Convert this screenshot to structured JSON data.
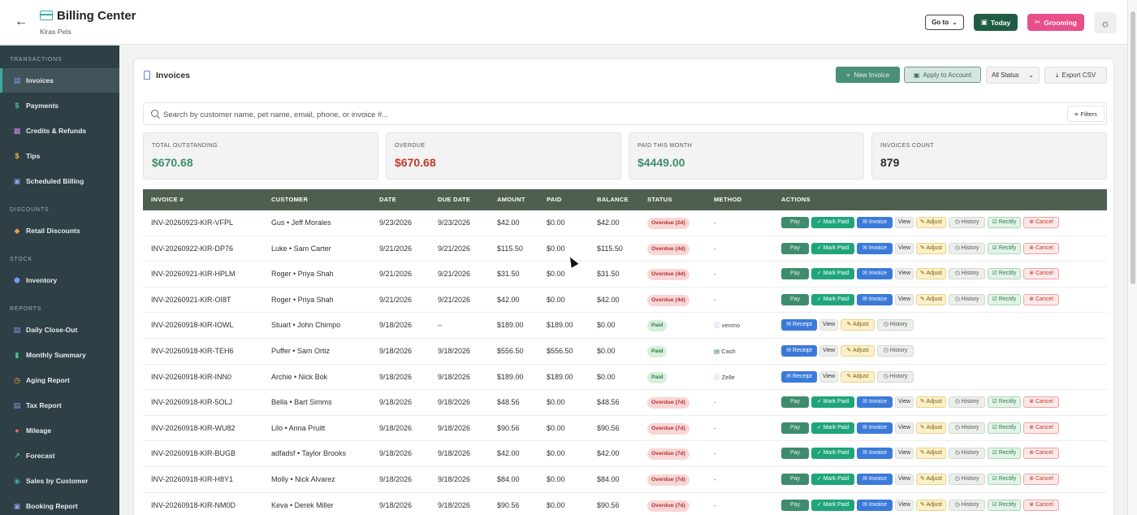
{
  "header": {
    "title": "Billing Center",
    "subtitle": "Kiras Pets",
    "goto_label": "Go to",
    "today_label": "Today",
    "grooming_label": "Grooming",
    "back_icon": "arrow-left-icon",
    "theme_icon": "sun-icon"
  },
  "sidebar": {
    "sections": [
      {
        "label": "TRANSACTIONS",
        "items": [
          {
            "label": "Invoices",
            "icon": "document-icon",
            "active": true
          },
          {
            "label": "Payments",
            "icon": "dollar-icon"
          },
          {
            "label": "Credits & Refunds",
            "icon": "gift-icon"
          },
          {
            "label": "Tips",
            "icon": "dollar-icon"
          },
          {
            "label": "Scheduled Billing",
            "icon": "calendar-icon"
          }
        ]
      },
      {
        "label": "DISCOUNTS",
        "items": [
          {
            "label": "Retail Discounts",
            "icon": "tag-icon"
          }
        ]
      },
      {
        "label": "STOCK",
        "items": [
          {
            "label": "Inventory",
            "icon": "box-icon"
          }
        ]
      },
      {
        "label": "REPORTS",
        "items": [
          {
            "label": "Daily Close-Out",
            "icon": "clipboard-icon"
          },
          {
            "label": "Monthly Summary",
            "icon": "bar-chart-icon"
          },
          {
            "label": "Aging Report",
            "icon": "clock-icon"
          },
          {
            "label": "Tax Report",
            "icon": "receipt-icon"
          },
          {
            "label": "Mileage",
            "icon": "map-pin-icon"
          },
          {
            "label": "Forecast",
            "icon": "trend-icon"
          },
          {
            "label": "Sales by Customer",
            "icon": "users-icon"
          },
          {
            "label": "Booking Report",
            "icon": "calendar-icon"
          }
        ]
      }
    ]
  },
  "invoices": {
    "title": "Invoices",
    "new_label": "New Invoice",
    "apply_label": "Apply to Account",
    "status_filter": "All Status",
    "export_label": "Export CSV",
    "search_placeholder": "Search by customer name, pet name, email, phone, or invoice #...",
    "filters_label": "Filters"
  },
  "stats": [
    {
      "label": "TOTAL OUTSTANDING",
      "value": "$670.68",
      "color": "#3f8f6e"
    },
    {
      "label": "OVERDUE",
      "value": "$670.68",
      "color": "#c0392b"
    },
    {
      "label": "PAID THIS MONTH",
      "value": "$4449.00",
      "color": "#3f8f6e"
    },
    {
      "label": "INVOICES COUNT",
      "value": "879",
      "color": "#2b2f2b"
    }
  ],
  "table": {
    "columns": [
      "INVOICE #",
      "CUSTOMER",
      "DATE",
      "DUE DATE",
      "AMOUNT",
      "PAID",
      "BALANCE",
      "STATUS",
      "METHOD",
      "ACTIONS"
    ],
    "action_labels": {
      "pay": "Pay",
      "mark_paid": "Mark Paid",
      "invoice": "Invoice",
      "view": "View",
      "adjust": "Adjust",
      "history": "History",
      "rectify": "Rectify",
      "cancel": "Cancel",
      "receipt": "Receipt"
    },
    "rows": [
      {
        "invoice": "INV-20260923-KIR-VFPL",
        "customer": "Gus • Jeff Morales",
        "date": "9/23/2026",
        "due": "9/23/2026",
        "amount": "$42.00",
        "paid": "$0.00",
        "balance": "$42.00",
        "status": "Overdue (2d)",
        "status_type": "overdue",
        "method": "-"
      },
      {
        "invoice": "INV-20260922-KIR-DP76",
        "customer": "Luke • Sam Carter",
        "date": "9/21/2026",
        "due": "9/21/2026",
        "amount": "$115.50",
        "paid": "$0.00",
        "balance": "$115.50",
        "status": "Overdue (4d)",
        "status_type": "overdue",
        "method": "-"
      },
      {
        "invoice": "INV-20260921-KIR-HPLM",
        "customer": "Roger • Priya Shah",
        "date": "9/21/2026",
        "due": "9/21/2026",
        "amount": "$31.50",
        "paid": "$0.00",
        "balance": "$31.50",
        "status": "Overdue (4d)",
        "status_type": "overdue",
        "method": "-"
      },
      {
        "invoice": "INV-20260921-KIR-OI8T",
        "customer": "Roger • Priya Shah",
        "date": "9/21/2026",
        "due": "9/21/2026",
        "amount": "$42.00",
        "paid": "$0.00",
        "balance": "$42.00",
        "status": "Overdue (4d)",
        "status_type": "overdue",
        "method": "-"
      },
      {
        "invoice": "INV-20260918-KIR-IOWL",
        "customer": "Stuart • John Chimpo",
        "date": "9/18/2026",
        "due": "–",
        "amount": "$189.00",
        "paid": "$189.00",
        "balance": "$0.00",
        "status": "Paid",
        "status_type": "paid",
        "method": "venmo"
      },
      {
        "invoice": "INV-20260918-KIR-TEH6",
        "customer": "Puffer • Sam Ortiz",
        "date": "9/18/2026",
        "due": "9/18/2026",
        "amount": "$556.50",
        "paid": "$556.50",
        "balance": "$0.00",
        "status": "Paid",
        "status_type": "paid",
        "method": "Cash"
      },
      {
        "invoice": "INV-20260918-KIR-INN0",
        "customer": "Archie • Nick Bok",
        "date": "9/18/2026",
        "due": "9/18/2026",
        "amount": "$189.00",
        "paid": "$189.00",
        "balance": "$0.00",
        "status": "Paid",
        "status_type": "paid",
        "method": "Zelle"
      },
      {
        "invoice": "INV-20260918-KIR-5OLJ",
        "customer": "Bella • Bart Simms",
        "date": "9/18/2026",
        "due": "9/18/2026",
        "amount": "$48.56",
        "paid": "$0.00",
        "balance": "$48.56",
        "status": "Overdue (7d)",
        "status_type": "overdue",
        "method": "-"
      },
      {
        "invoice": "INV-20260918-KIR-WU82",
        "customer": "Lilo • Anna Pruitt",
        "date": "9/18/2026",
        "due": "9/18/2026",
        "amount": "$90.56",
        "paid": "$0.00",
        "balance": "$90.56",
        "status": "Overdue (7d)",
        "status_type": "overdue",
        "method": "-"
      },
      {
        "invoice": "INV-20260918-KIR-BUGB",
        "customer": "adfadsf • Taylor Brooks",
        "date": "9/18/2026",
        "due": "9/18/2026",
        "amount": "$42.00",
        "paid": "$0.00",
        "balance": "$42.00",
        "status": "Overdue (7d)",
        "status_type": "overdue",
        "method": "-"
      },
      {
        "invoice": "INV-20260918-KIR-H8Y1",
        "customer": "Molly • Nick Alvarez",
        "date": "9/18/2026",
        "due": "9/18/2026",
        "amount": "$84.00",
        "paid": "$0.00",
        "balance": "$84.00",
        "status": "Overdue (7d)",
        "status_type": "overdue",
        "method": "-"
      },
      {
        "invoice": "INV-20260918-KIR-NM0D",
        "customer": "Keva • Derek Miller",
        "date": "9/18/2026",
        "due": "9/18/2026",
        "amount": "$90.56",
        "paid": "$0.00",
        "balance": "$90.56",
        "status": "Overdue (7d)",
        "status_type": "overdue",
        "method": "-"
      }
    ]
  }
}
